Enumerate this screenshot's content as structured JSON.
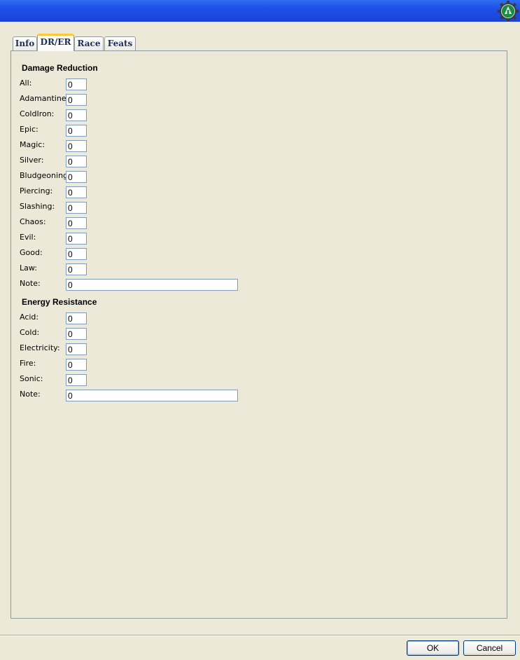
{
  "tabs": [
    {
      "label": "Info"
    },
    {
      "label": "DR/ER"
    },
    {
      "label": "Race"
    },
    {
      "label": "Feats"
    }
  ],
  "damage_reduction": {
    "title": "Damage Reduction",
    "rows": [
      {
        "label": "All:",
        "value": "0"
      },
      {
        "label": "Adamantine:",
        "value": "0"
      },
      {
        "label": "ColdIron:",
        "value": "0"
      },
      {
        "label": "Epic:",
        "value": "0"
      },
      {
        "label": "Magic:",
        "value": "0"
      },
      {
        "label": "Silver:",
        "value": "0"
      },
      {
        "label": "Bludgeoning:",
        "value": "0"
      },
      {
        "label": "Piercing:",
        "value": "0"
      },
      {
        "label": "Slashing:",
        "value": "0"
      },
      {
        "label": "Chaos:",
        "value": "0"
      },
      {
        "label": "Evil:",
        "value": "0"
      },
      {
        "label": "Good:",
        "value": "0"
      },
      {
        "label": "Law:",
        "value": "0"
      }
    ],
    "note": {
      "label": "Note:",
      "value": "0"
    }
  },
  "energy_resistance": {
    "title": "Energy Resistance",
    "rows": [
      {
        "label": "Acid:",
        "value": "0"
      },
      {
        "label": "Cold:",
        "value": "0"
      },
      {
        "label": "Electricity:",
        "value": "0"
      },
      {
        "label": "Fire:",
        "value": "0"
      },
      {
        "label": "Sonic:",
        "value": "0"
      }
    ],
    "note": {
      "label": "Note:",
      "value": "0"
    }
  },
  "buttons": {
    "ok": "OK",
    "cancel": "Cancel"
  },
  "icons": {
    "app": "app-gear-icon"
  },
  "colors": {
    "titlebar": "#1E50E8",
    "active_tab_accent": "#FFC83C",
    "dialog_bg": "#ECE9D8"
  }
}
